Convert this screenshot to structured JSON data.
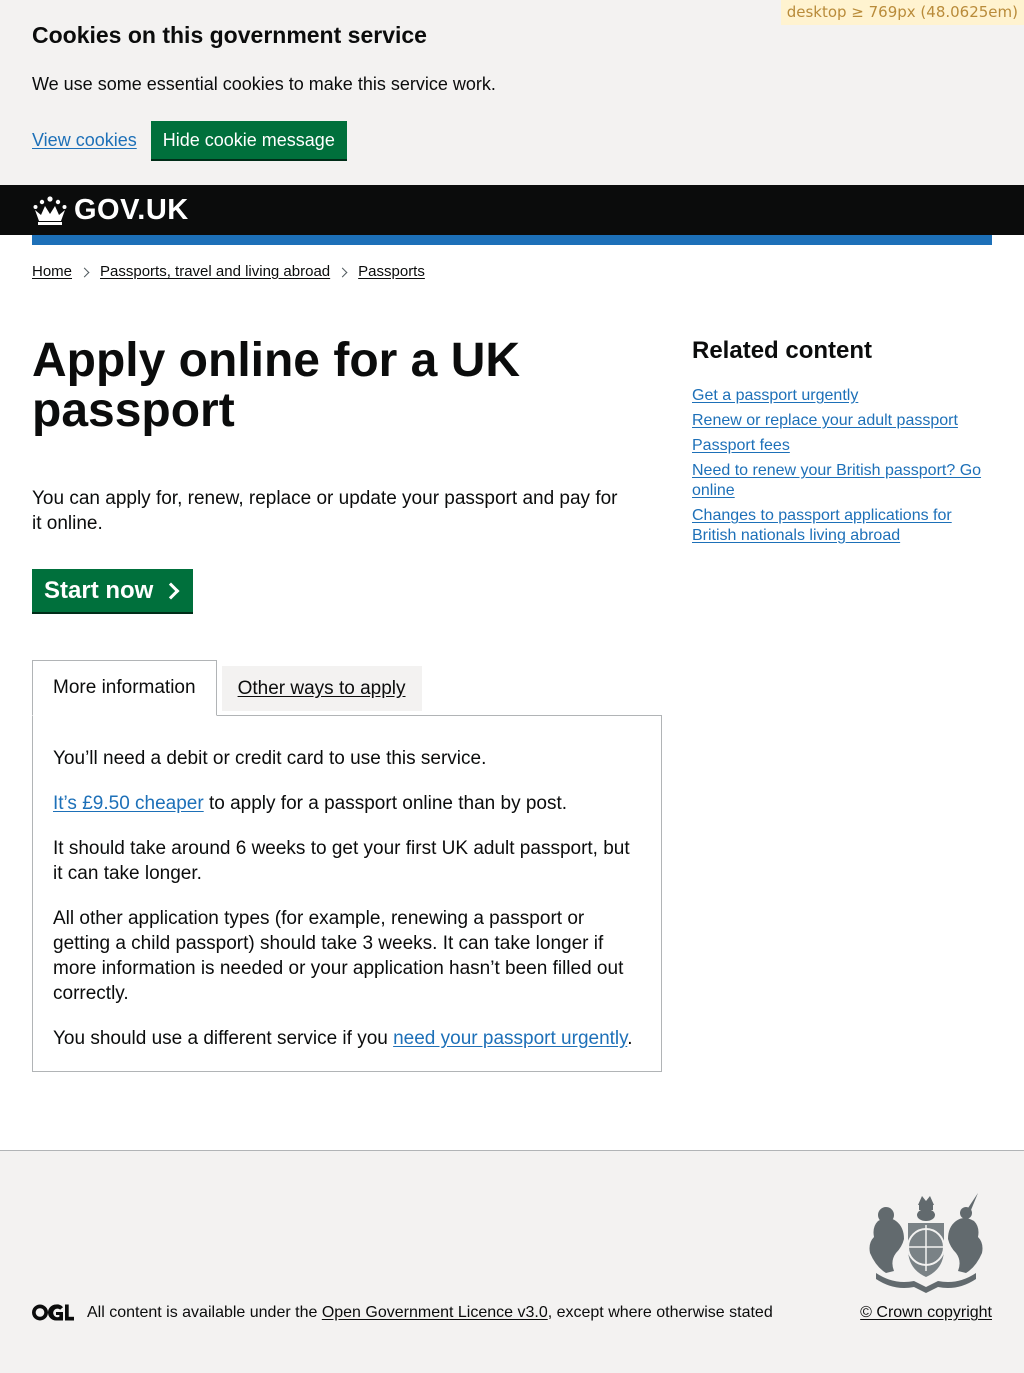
{
  "debug": {
    "breakpoint_label": "desktop ≥ 769px (48.0625em)"
  },
  "cookie_banner": {
    "heading": "Cookies on this government service",
    "message": "We use some essential cookies to make this service work.",
    "view_link": "View cookies",
    "hide_button": "Hide cookie message"
  },
  "header": {
    "logotype": "GOV.UK",
    "logo_icon": "crown-icon"
  },
  "breadcrumbs": [
    "Home",
    "Passports, travel and living abroad",
    "Passports"
  ],
  "main": {
    "title": "Apply online for a UK passport",
    "lead": "You can apply for, renew, replace or update your passport and pay for it online.",
    "start_button": "Start now",
    "tabs": {
      "active": "More information",
      "inactive": "Other ways to apply"
    },
    "panel": {
      "p1": "You’ll need a debit or credit card to use this service.",
      "p2_link": "It’s £9.50 cheaper",
      "p2_rest": " to apply for a passport online than by post.",
      "p3": "It should take around 6 weeks to get your first UK adult passport, but it can take longer.",
      "p4": "All other application types (for example, renewing a passport or getting a child passport) should take 3 weeks. It can take longer if more information is needed or your application hasn’t been filled out correctly.",
      "p5_start": "You should use a different service if you ",
      "p5_link": "need your passport urgently",
      "p5_end": "."
    }
  },
  "sidebar": {
    "heading": "Related content",
    "links": [
      "Get a passport urgently",
      "Renew or replace your adult passport",
      "Passport fees",
      "Need to renew your British passport? Go online",
      "Changes to passport applications for British nationals living abroad"
    ]
  },
  "footer": {
    "licence_prefix": "All content is available under the ",
    "licence_link": "Open Government Licence v3.0",
    "licence_suffix": ", except where otherwise stated",
    "copyright": "© Crown copyright",
    "ogl_icon": "ogl-icon",
    "crest_icon": "royal-coat-of-arms-icon"
  },
  "colors": {
    "link": "#1d70b8",
    "button_green": "#00703c",
    "header_black": "#0b0c0c",
    "accent_blue": "#1d70b8",
    "footer_bg": "#f3f2f1"
  }
}
